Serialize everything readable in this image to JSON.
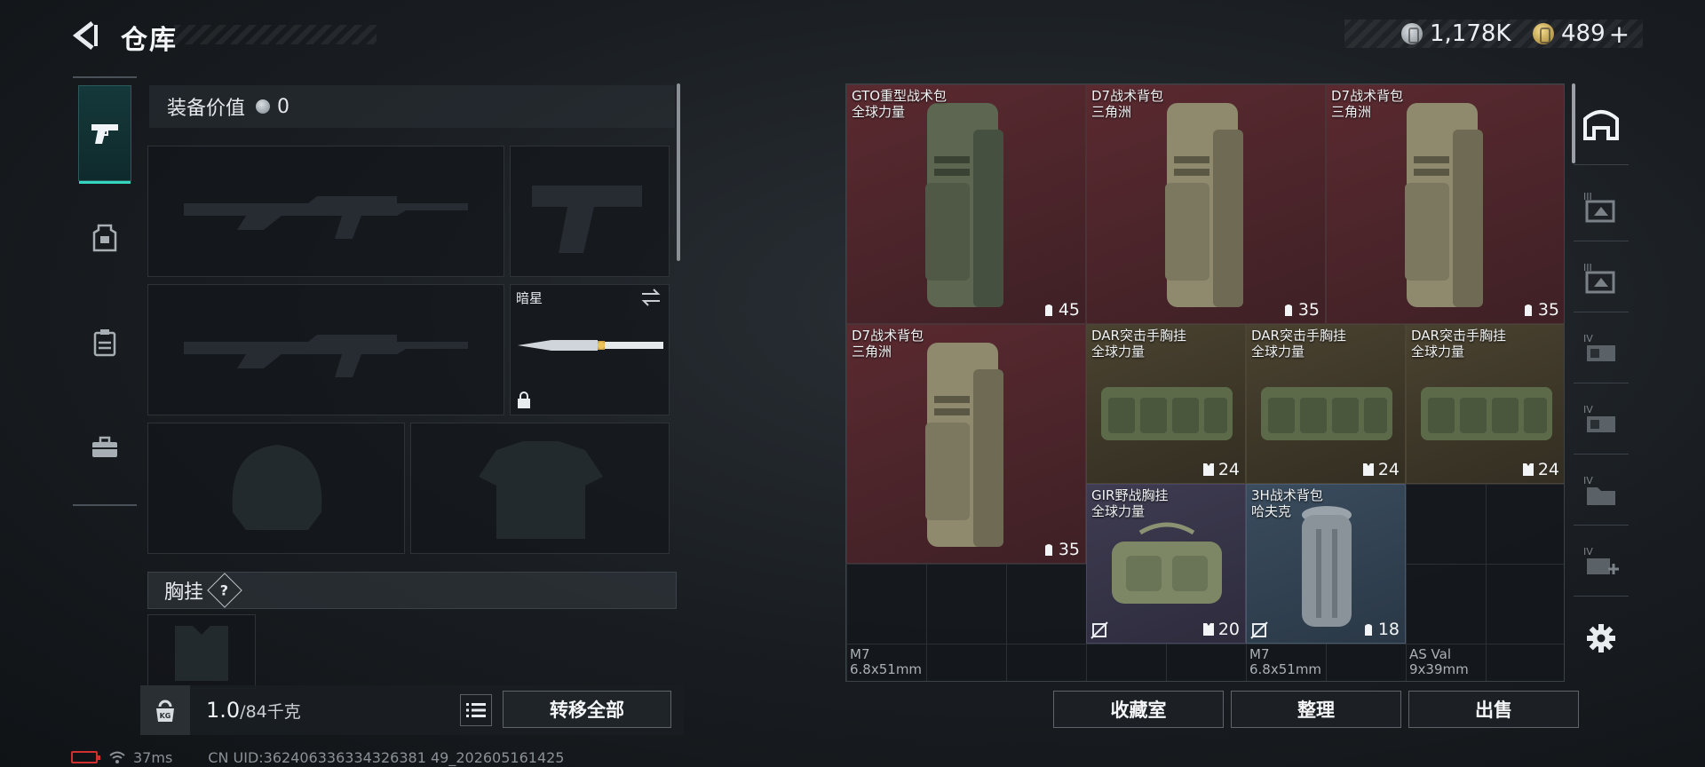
{
  "header": {
    "title": "仓库",
    "currency_silver": "1,178K",
    "currency_gold": "489",
    "plus_label": "+"
  },
  "equipment": {
    "value_label": "装备价值",
    "value": "0",
    "knife_name": "暗星",
    "chest_label": "胸挂",
    "help_label": "?"
  },
  "bottom_left": {
    "weight_current": "1.0",
    "weight_max": "/84千克",
    "kg_badge": "KG",
    "transfer_all_label": "转移全部"
  },
  "status_bar": {
    "ping": "37ms",
    "uid": "CN UID:362406336334326381 49_202605161425"
  },
  "stash": {
    "items": [
      {
        "name": "GTO重型战术包",
        "sub": "全球力量",
        "count": "45",
        "count_icon": "backpack-icon",
        "color": "#5a2a30"
      },
      {
        "name": "D7战术背包",
        "sub": "三角洲",
        "count": "35",
        "count_icon": "backpack-icon",
        "color": "#5a2a30"
      },
      {
        "name": "D7战术背包",
        "sub": "三角洲",
        "count": "35",
        "count_icon": "backpack-icon",
        "color": "#5a2a30"
      },
      {
        "name": "D7战术背包",
        "sub": "三角洲",
        "count": "35",
        "count_icon": "backpack-icon",
        "color": "#5a2a30"
      },
      {
        "name": "DAR突击手胸挂",
        "sub": "全球力量",
        "count": "24",
        "count_icon": "vest-icon",
        "color": "#4a4230"
      },
      {
        "name": "DAR突击手胸挂",
        "sub": "全球力量",
        "count": "24",
        "count_icon": "vest-icon",
        "color": "#4a4230"
      },
      {
        "name": "DAR突击手胸挂",
        "sub": "全球力量",
        "count": "24",
        "count_icon": "vest-icon",
        "color": "#4a4230"
      },
      {
        "name": "GIR野战胸挂",
        "sub": "全球力量",
        "count": "20",
        "count_icon": "vest-icon",
        "color": "#3f3c52"
      },
      {
        "name": "3H战术背包",
        "sub": "哈夫克",
        "count": "18",
        "count_icon": "backpack-icon",
        "color": "#3a4c5e"
      }
    ],
    "ammo": [
      {
        "name": "M7",
        "caliber": "6.8x51mm"
      },
      {
        "name": "M7",
        "caliber": "6.8x51mm"
      },
      {
        "name": "AS Val",
        "caliber": "9x39mm"
      }
    ]
  },
  "bottom_right": {
    "collection_label": "收藏室",
    "sort_label": "整理",
    "sell_label": "出售"
  },
  "right_strip": {
    "tiers": [
      "III",
      "III",
      "IV",
      "IV",
      "IV",
      "IV"
    ]
  }
}
